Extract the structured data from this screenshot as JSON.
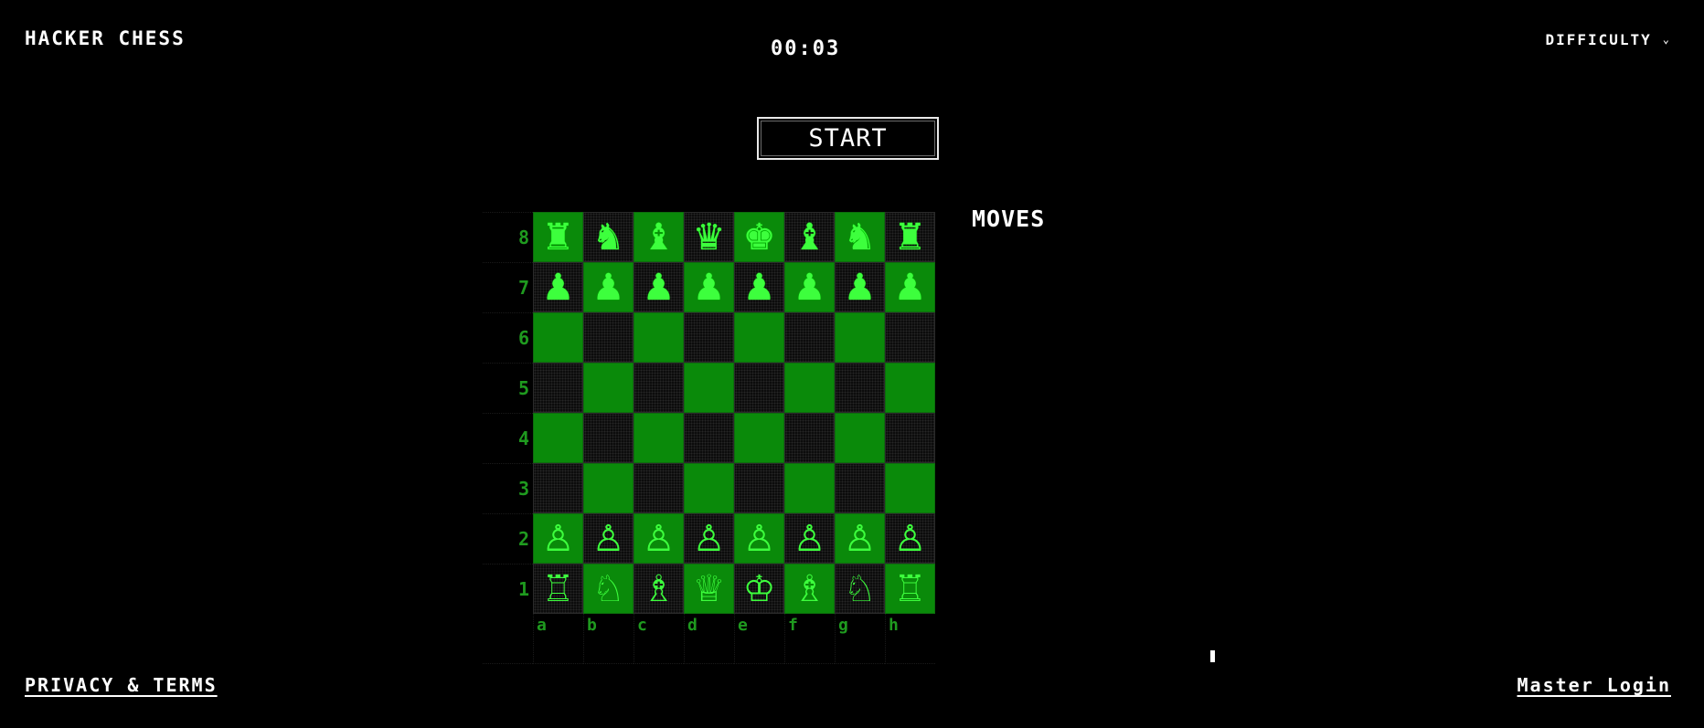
{
  "header": {
    "title": "HACKER CHESS",
    "timer": "00:03",
    "difficulty_label": "DIFFICULTY",
    "difficulty_icon": "chevron-down-icon"
  },
  "controls": {
    "start_label": "START"
  },
  "board": {
    "ranks": [
      "8",
      "7",
      "6",
      "5",
      "4",
      "3",
      "2",
      "1"
    ],
    "files": [
      "a",
      "b",
      "c",
      "d",
      "e",
      "f",
      "g",
      "h"
    ],
    "light_color": "#0a8a0a",
    "dark_color": "#0c0c0c",
    "piece_color": "#3dff3d",
    "position": [
      [
        "♜",
        "♞",
        "♝",
        "♛",
        "♚",
        "♝",
        "♞",
        "♜"
      ],
      [
        "♟",
        "♟",
        "♟",
        "♟",
        "♟",
        "♟",
        "♟",
        "♟"
      ],
      [
        "",
        "",
        "",
        "",
        "",
        "",
        "",
        ""
      ],
      [
        "",
        "",
        "",
        "",
        "",
        "",
        "",
        ""
      ],
      [
        "",
        "",
        "",
        "",
        "",
        "",
        "",
        ""
      ],
      [
        "",
        "",
        "",
        "",
        "",
        "",
        "",
        ""
      ],
      [
        "♙",
        "♙",
        "♙",
        "♙",
        "♙",
        "♙",
        "♙",
        "♙"
      ],
      [
        "♖",
        "♘",
        "♗",
        "♕",
        "♔",
        "♗",
        "♘",
        "♖"
      ]
    ]
  },
  "moves": {
    "title": "MOVES",
    "list": []
  },
  "footer": {
    "privacy_label": "PRIVACY & TERMS",
    "login_label": "Master Login"
  }
}
